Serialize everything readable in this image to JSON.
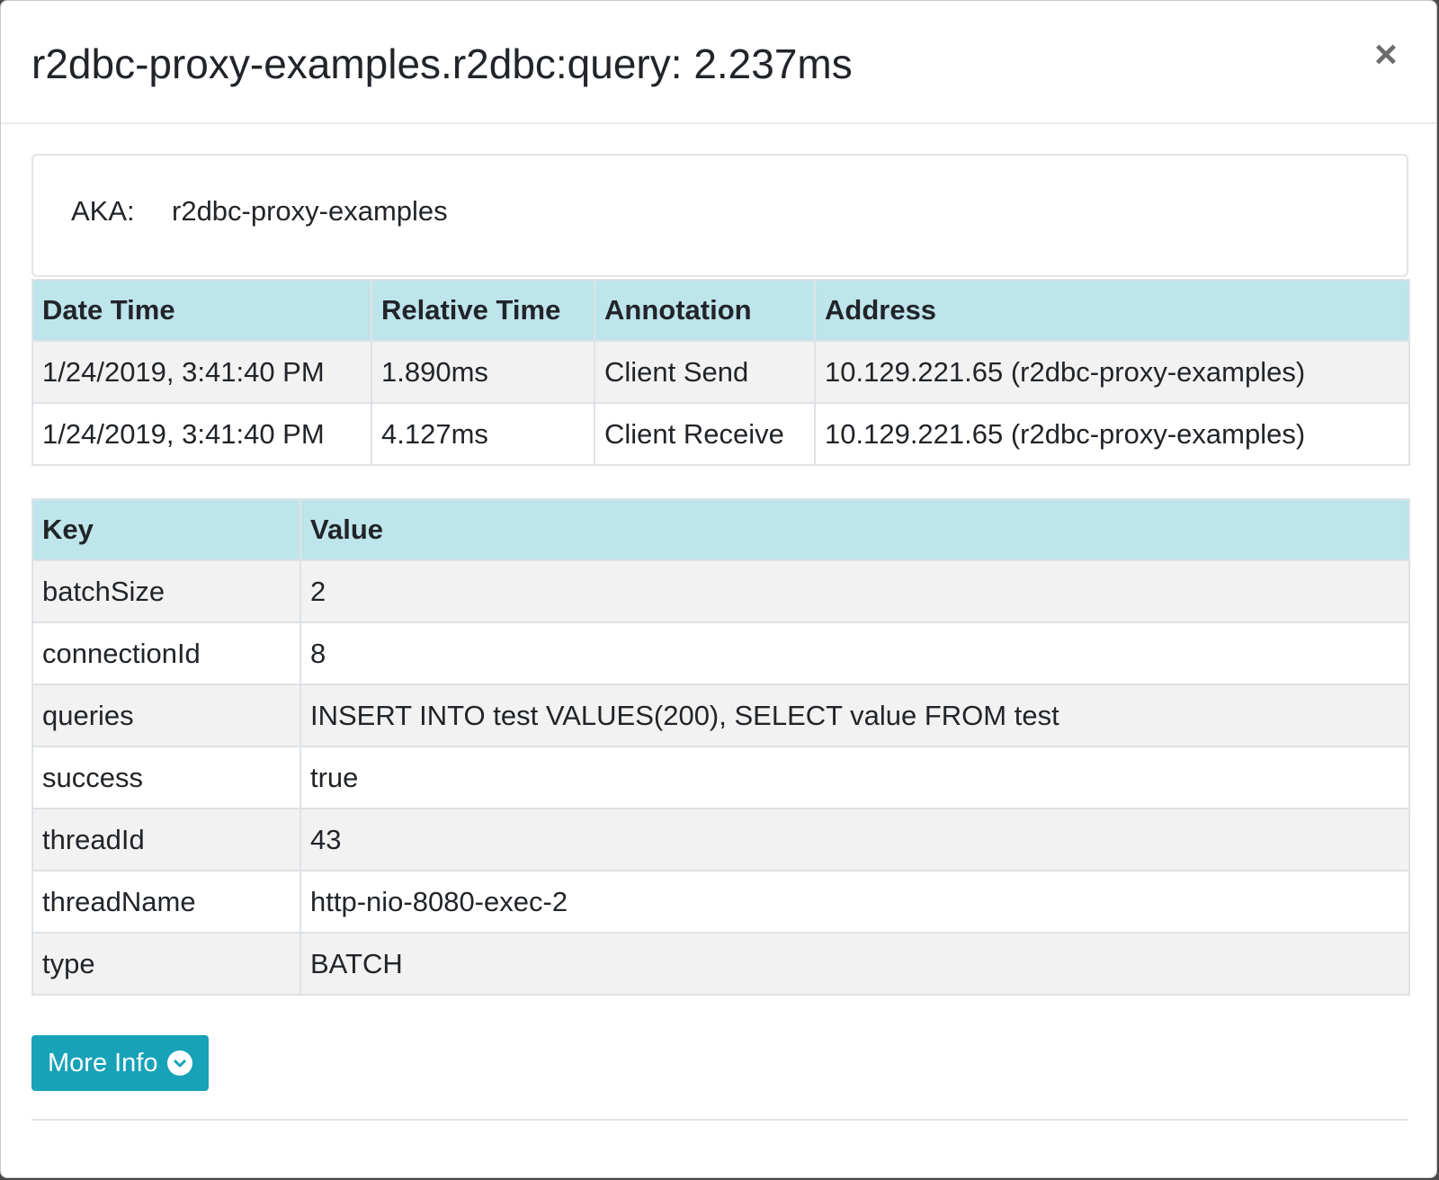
{
  "modal": {
    "title": "r2dbc-proxy-examples.r2dbc:query: 2.237ms",
    "close_label": "×"
  },
  "aka": {
    "label": "AKA:",
    "value": "r2dbc-proxy-examples"
  },
  "annotations": {
    "headers": [
      "Date Time",
      "Relative Time",
      "Annotation",
      "Address"
    ],
    "rows": [
      [
        "1/24/2019, 3:41:40 PM",
        "1.890ms",
        "Client Send",
        "10.129.221.65 (r2dbc-proxy-examples)"
      ],
      [
        "1/24/2019, 3:41:40 PM",
        "4.127ms",
        "Client Receive",
        "10.129.221.65 (r2dbc-proxy-examples)"
      ]
    ]
  },
  "tags": {
    "headers": [
      "Key",
      "Value"
    ],
    "rows": [
      [
        "batchSize",
        "2"
      ],
      [
        "connectionId",
        "8"
      ],
      [
        "queries",
        "INSERT INTO test VALUES(200), SELECT value FROM test"
      ],
      [
        "success",
        "true"
      ],
      [
        "threadId",
        "43"
      ],
      [
        "threadName",
        "http-nio-8080-exec-2"
      ],
      [
        "type",
        "BATCH"
      ]
    ]
  },
  "more_info": {
    "label": "More Info",
    "icon": "chevron-circle-down-icon"
  },
  "colors": {
    "table_header_bg": "#bee5eb",
    "button_bg": "#17a2b8",
    "stripe_bg": "#f2f2f2"
  }
}
